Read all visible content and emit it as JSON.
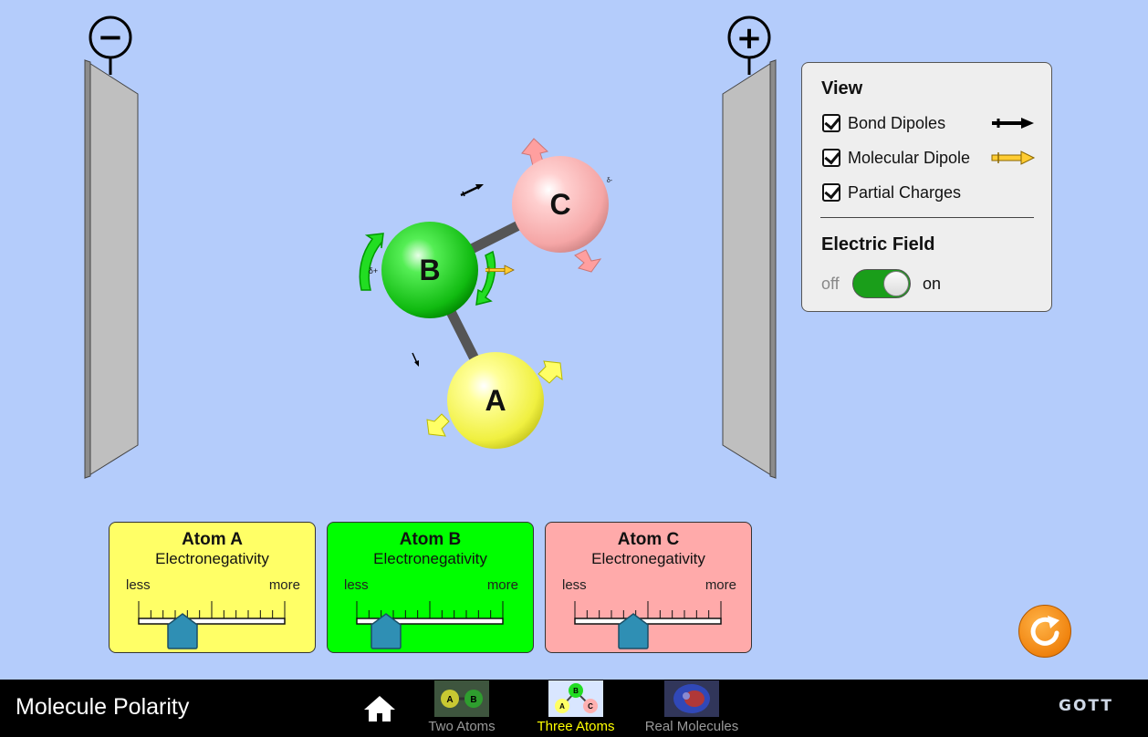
{
  "app": {
    "title": "Molecule Polarity"
  },
  "plates": {
    "negative_symbol": "−",
    "positive_symbol": "+"
  },
  "molecule": {
    "atoms": [
      {
        "id": "A",
        "label": "A",
        "color": "#ffff66"
      },
      {
        "id": "B",
        "label": "B",
        "color": "#22dd22"
      },
      {
        "id": "C",
        "label": "C",
        "color": "#ff9f9f"
      }
    ],
    "partial_charges": {
      "B": "δ+",
      "C": "δ-"
    }
  },
  "view_panel": {
    "heading": "View",
    "options": [
      {
        "label": "Bond Dipoles",
        "checked": true,
        "legend": "black-arrow"
      },
      {
        "label": "Molecular Dipole",
        "checked": true,
        "legend": "yellow-arrow"
      },
      {
        "label": "Partial Charges",
        "checked": true
      }
    ],
    "electric_field": {
      "heading": "Electric Field",
      "off_label": "off",
      "on_label": "on",
      "state": "on"
    }
  },
  "electronegativity": [
    {
      "title": "Atom A",
      "subtitle": "Electronegativity",
      "less": "less",
      "more": "more",
      "color": "#ffff66",
      "value": 0.3
    },
    {
      "title": "Atom B",
      "subtitle": "Electronegativity",
      "less": "less",
      "more": "more",
      "color": "#00ff00",
      "value": 0.2
    },
    {
      "title": "Atom C",
      "subtitle": "Electronegativity",
      "less": "less",
      "more": "more",
      "color": "#ffaaaa",
      "value": 0.4
    }
  ],
  "nav": {
    "home_icon": "home-icon",
    "tabs": [
      {
        "label": "Two Atoms",
        "selected": false,
        "thumb_atoms": [
          "A",
          "B"
        ]
      },
      {
        "label": "Three Atoms",
        "selected": true,
        "thumb_atoms": [
          "A",
          "B",
          "C"
        ]
      },
      {
        "label": "Real Molecules",
        "selected": false
      }
    ],
    "brand": "GOTT"
  },
  "colors": {
    "background": "#b4ccfb",
    "selected_tab": "#ffff00",
    "unselected_tab": "#999999",
    "reset": "#f0830e"
  }
}
